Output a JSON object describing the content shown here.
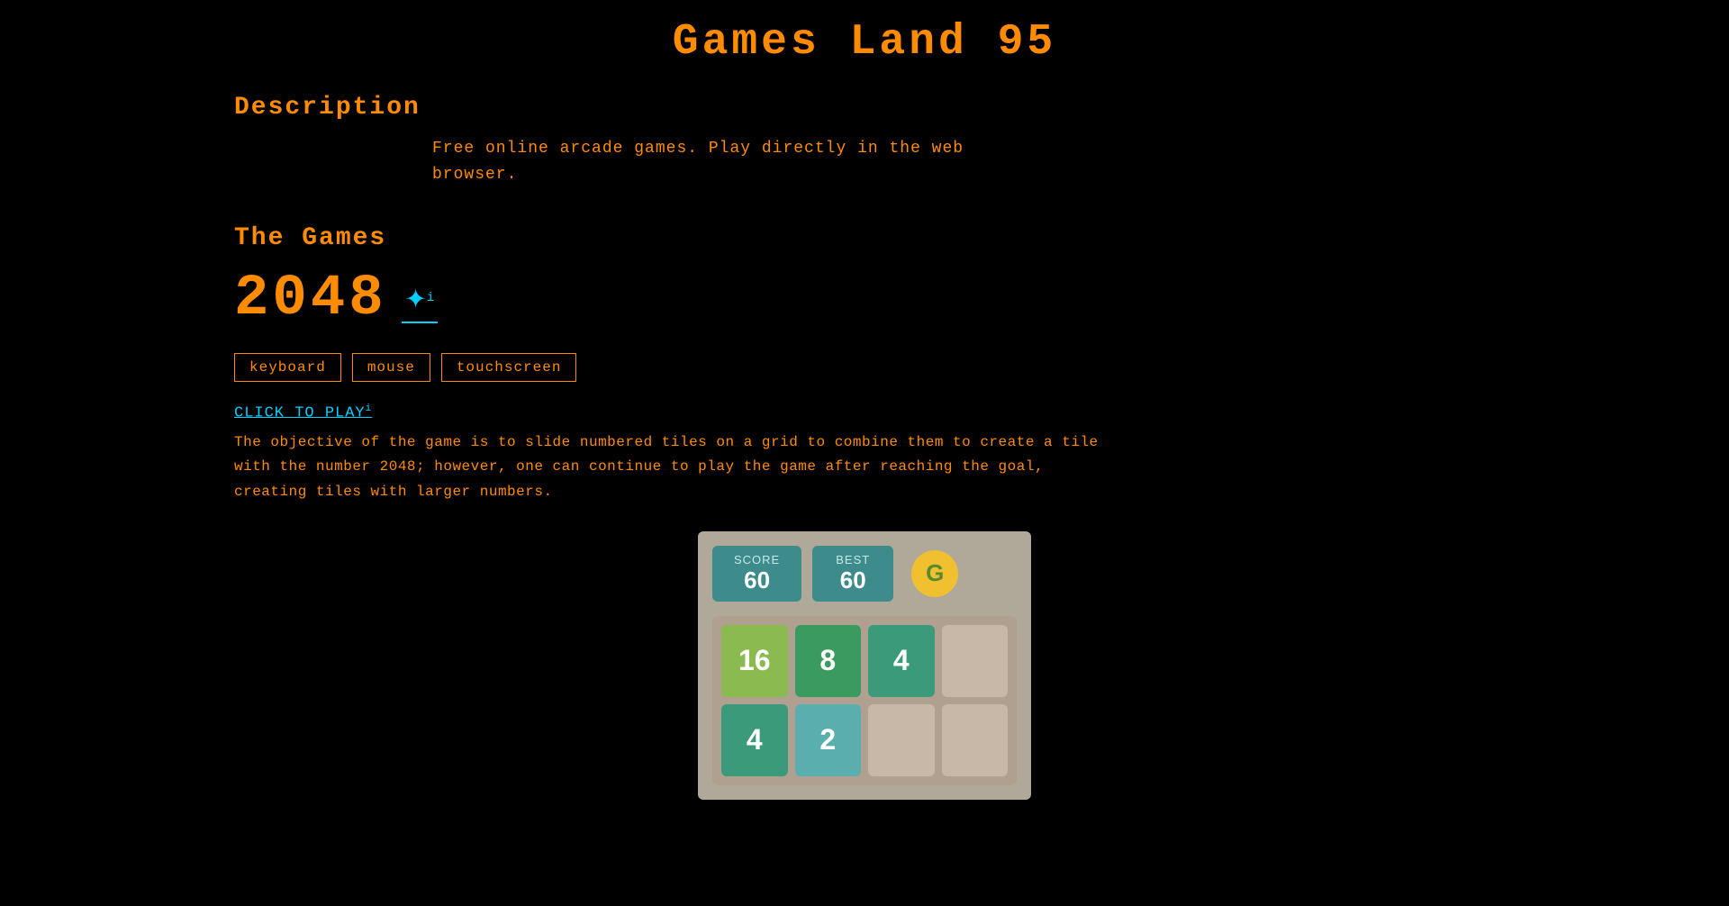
{
  "header": {
    "title": "Games Land 95"
  },
  "description": {
    "heading": "Description",
    "text_line1": "Free online arcade games. Play directly in the web",
    "text_line2": "browser."
  },
  "games": {
    "heading": "The Games",
    "game": {
      "title": "2048",
      "icon_symbol": "✦",
      "icon_super": "i",
      "tags": [
        "keyboard",
        "mouse",
        "touchscreen"
      ],
      "click_to_play": "CLICK TO PLAY",
      "click_super": "i",
      "objective": "The objective of the game is to slide numbered tiles on a grid to combine them to create a tile with the number 2048; however, one can continue to play the game after reaching the goal, creating tiles with larger numbers.",
      "preview": {
        "score_label": "SCORE",
        "score_value": "60",
        "best_label": "BEST",
        "best_value": "60",
        "button_icon": "G",
        "grid": [
          {
            "value": "16",
            "type": "tile-16"
          },
          {
            "value": "8",
            "type": "tile-8"
          },
          {
            "value": "4",
            "type": "tile-4"
          },
          {
            "value": "",
            "type": "tile-empty"
          },
          {
            "value": "4",
            "type": "tile-4"
          },
          {
            "value": "2",
            "type": "tile-2"
          },
          {
            "value": "",
            "type": "tile-empty"
          },
          {
            "value": "",
            "type": "tile-empty"
          }
        ]
      }
    }
  }
}
